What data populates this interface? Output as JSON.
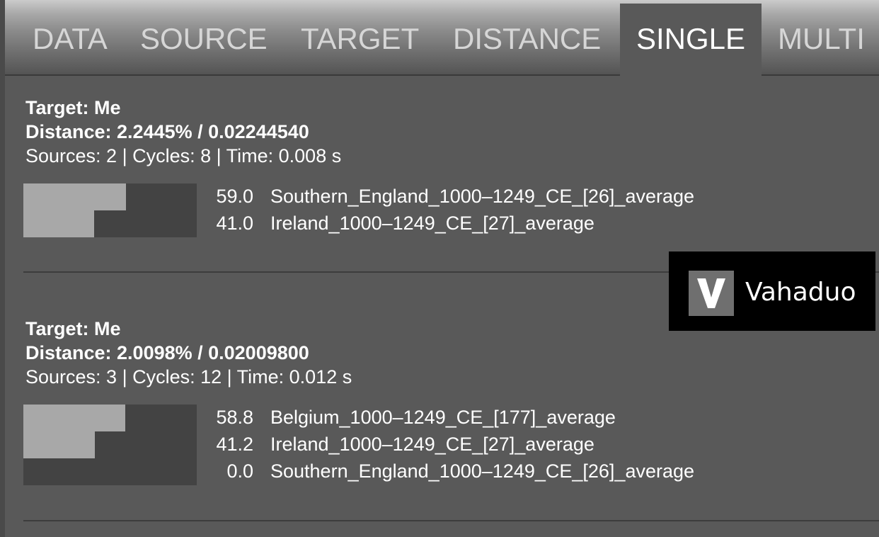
{
  "tabs": [
    {
      "label": "DATA",
      "active": false
    },
    {
      "label": "SOURCE",
      "active": false
    },
    {
      "label": "TARGET",
      "active": false
    },
    {
      "label": "DISTANCE",
      "active": false
    },
    {
      "label": "SINGLE",
      "active": true
    },
    {
      "label": "MULTI",
      "active": false
    }
  ],
  "results": [
    {
      "target": "Target: Me",
      "distance": "Distance: 2.2445% / 0.02244540",
      "stats": "Sources: 2 | Cycles: 8 | Time: 0.008 s",
      "sources": [
        {
          "pct": "59.0",
          "name": "Southern_England_1000–1249_CE_[26]_average",
          "value": 59.0
        },
        {
          "pct": "41.0",
          "name": "Ireland_1000–1249_CE_[27]_average",
          "value": 41.0
        }
      ]
    },
    {
      "target": "Target: Me",
      "distance": "Distance: 2.0098% / 0.02009800",
      "stats": "Sources: 3 | Cycles: 12 | Time: 0.012 s",
      "sources": [
        {
          "pct": "58.8",
          "name": "Belgium_1000–1249_CE_[177]_average",
          "value": 58.8
        },
        {
          "pct": "41.2",
          "name": "Ireland_1000–1249_CE_[27]_average",
          "value": 41.2
        },
        {
          "pct": "0.0",
          "name": "Southern_England_1000–1249_CE_[26]_average",
          "value": 0.0
        }
      ]
    }
  ],
  "watermark": {
    "logo_letter": "V",
    "text": "Vahaduo"
  },
  "colors": {
    "panel_background": "#595959",
    "bar_fill": "#a8a8a8",
    "bar_track": "#434343",
    "active_tab": "#595959"
  }
}
